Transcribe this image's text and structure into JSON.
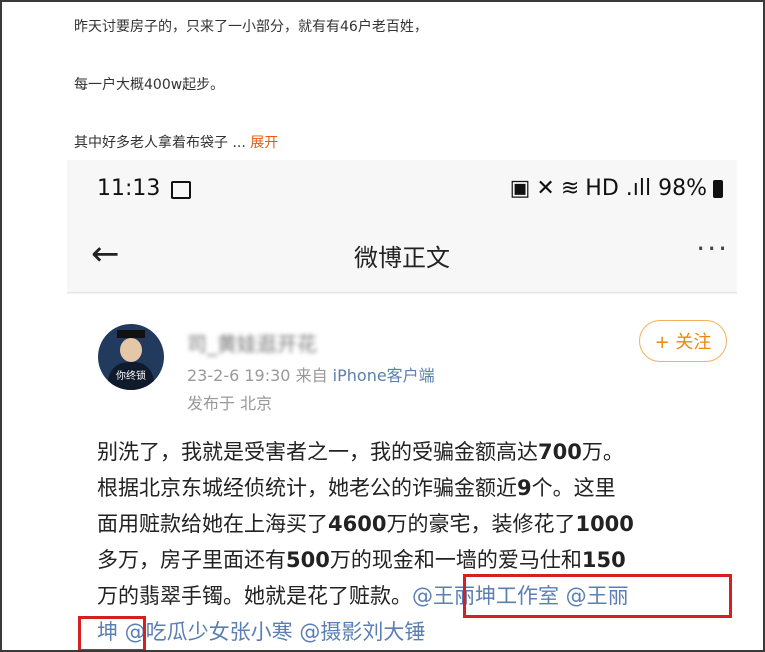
{
  "post": {
    "line1": "昨天讨要房子的，只来了一小部分，就有有46户老百姓，",
    "line2": "每一户大概400w起步。",
    "line3": "其中好多老人拿着布袋子 ...",
    "expand": "展开"
  },
  "status_bar": {
    "time": "11:13",
    "right": "HD .ıll 98%",
    "icons": [
      "image-icon",
      "battery-saver-icon",
      "mute-icon",
      "wifi-icon",
      "signal-icon",
      "battery-icon"
    ]
  },
  "weibo": {
    "title": "微博正文",
    "back_icon": "←",
    "more_icon": "···",
    "username": "司_黄娃逛开花",
    "avatar_label": "你终锁",
    "date": "23-2-6 19:30",
    "from": "来自",
    "source": "iPhone客户端",
    "location": "发布于 北京",
    "follow": "+ 关注",
    "body": {
      "l1a": "别洗了，我就是受害者之一，我的受骗金额高达",
      "l1b": "700",
      "l1c": "万。",
      "l2a": "根据北京东城经侦统计，她老公的诈骗金额近",
      "l2b": "9",
      "l2c": "个。这里",
      "l3a": "面用赃款给她在上海买了",
      "l3b": "4600",
      "l3c": "万的豪宅，装修花了",
      "l3d": "1000",
      "l4a": "多万，房子里面还有",
      "l4b": "500",
      "l4c": "万的现金和一墙的爱马仕和",
      "l4d": "150",
      "l5a": "万的翡翠手镯。她就是花了赃款。",
      "l5b": "@王丽坤工作室 @王丽",
      "l6a": "坤",
      "l6b": " @吃瓜少女张小寒 @摄影刘大锤"
    }
  },
  "colors": {
    "accent": "#e8590c",
    "mention": "#5b7fb3",
    "highlight": "#d42020",
    "follow": "#e58a12"
  }
}
